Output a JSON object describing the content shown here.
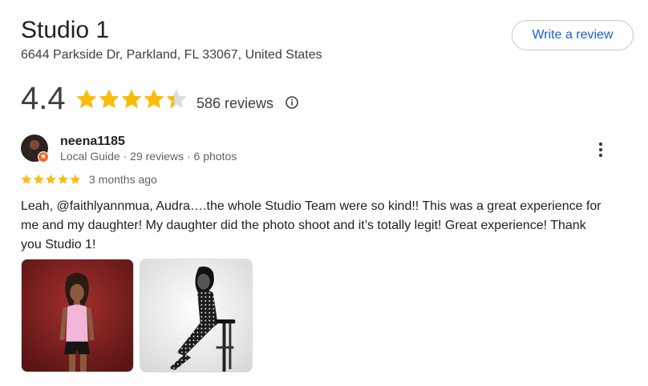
{
  "place": {
    "name": "Studio 1",
    "address": "6644 Parkside Dr, Parkland, FL 33067, United States",
    "write_review_label": "Write a review"
  },
  "rating": {
    "value": "4.4",
    "value_fraction": 0.88,
    "review_count_text": "586 reviews"
  },
  "review": {
    "author": "neena1185",
    "meta": "Local Guide · 29 reviews · 6 photos",
    "stars": 5,
    "date": "3 months ago",
    "text": "Leah, @faithlyannmua, Audra….the whole Studio Team were so kind!! This was a great experience for me and my daughter! My daughter did the photo shoot and it’s totally legit! Great experience! Thank you Studio 1!",
    "photos": [
      "photo-color-portrait",
      "photo-black-white-stool"
    ]
  },
  "colors": {
    "star": "#fbbc04",
    "star_empty": "#dadce0",
    "link_blue": "#1a5fd0",
    "local_guide_badge": "#ea6a2a"
  },
  "icons": {
    "info": "info-icon",
    "more": "more-vert-icon",
    "badge": "local-guide-star-icon"
  }
}
